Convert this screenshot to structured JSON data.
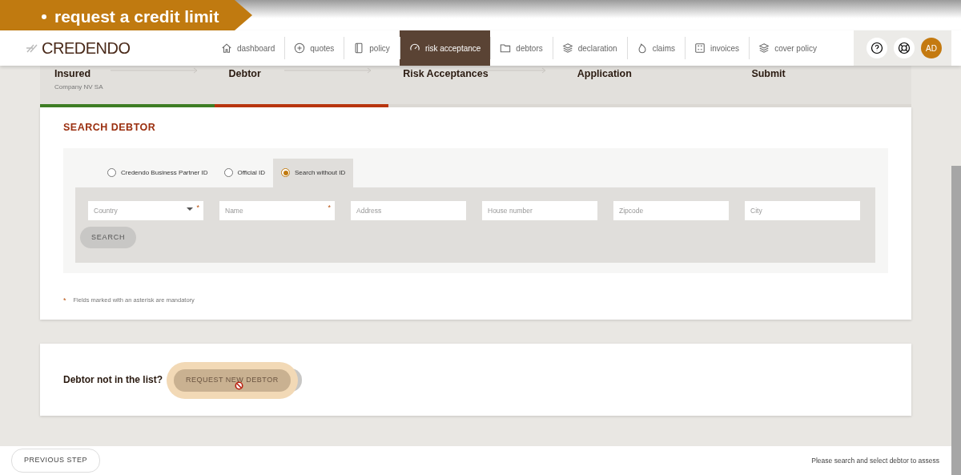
{
  "banner": {
    "title": "request a credit limit"
  },
  "navbar": {
    "logo": "CREDENDO",
    "items": [
      {
        "label": "dashboard",
        "selected": false
      },
      {
        "label": "quotes",
        "selected": false
      },
      {
        "label": "policy",
        "selected": false
      },
      {
        "label": "risk acceptance",
        "selected": true
      },
      {
        "label": "debtors",
        "selected": false
      },
      {
        "label": "declaration",
        "selected": false
      },
      {
        "label": "claims",
        "selected": false
      },
      {
        "label": "invoices",
        "selected": false
      },
      {
        "label": "cover policy",
        "selected": false
      }
    ],
    "avatar": "AD"
  },
  "steps": [
    {
      "title": "Insured",
      "subtitle": "Company NV SA",
      "completed": true,
      "selected": false
    },
    {
      "title": "Debtor",
      "completed": false,
      "selected": true
    },
    {
      "title": "Risk Acceptances",
      "completed": false,
      "selected": false
    },
    {
      "title": "Application",
      "completed": false,
      "selected": false
    },
    {
      "title": "Submit",
      "completed": false,
      "selected": false
    }
  ],
  "search_card": {
    "title": "SEARCH DEBTOR",
    "options": [
      {
        "label": "Credendo Business Partner ID",
        "selected": false
      },
      {
        "label": "Official ID",
        "selected": false
      },
      {
        "label": "Search without ID",
        "selected": true
      }
    ],
    "fields": [
      {
        "kind": "select",
        "placeholder": "Country",
        "required": true
      },
      {
        "kind": "text",
        "placeholder": "Name",
        "required": true
      },
      {
        "kind": "text",
        "placeholder": "Address",
        "required": false
      },
      {
        "kind": "text",
        "placeholder": "House number",
        "required": false
      },
      {
        "kind": "text",
        "placeholder": "Zipcode",
        "required": false
      },
      {
        "kind": "text",
        "placeholder": "City",
        "required": false
      }
    ],
    "search_button": "SEARCH",
    "footnote_mark": "*",
    "footnote": "Fields marked with an asterisk are mandatory"
  },
  "request_card": {
    "question": "Debtor not in the list?",
    "button": "REQUEST NEW DEBTOR",
    "disabled": true
  },
  "footer": {
    "previous_button": "PREVIOUS STEP",
    "hint": "Please search and select debtor to assess"
  }
}
